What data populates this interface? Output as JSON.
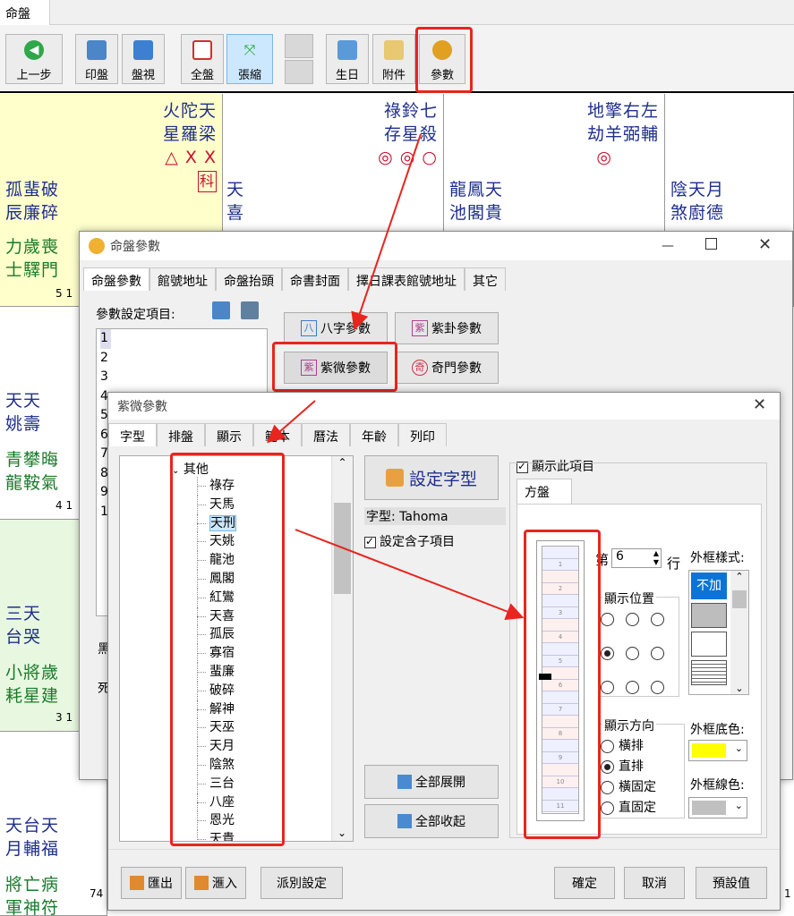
{
  "app": {
    "tab_label": "命盤"
  },
  "toolbar": {
    "back": "上一步",
    "print": "印盤",
    "view": "盤視",
    "full": "全盤",
    "zoom": "張縮",
    "birthday": "生日",
    "attach": "附件",
    "params": "參數"
  },
  "chart": {
    "c1_stars": [
      "火陀天",
      "星羅梁"
    ],
    "c1_marks": "△ X X",
    "c1_ke": "科",
    "c1_left": [
      "孤蜚破",
      "辰廉碎"
    ],
    "c1_bottom": [
      "力歲喪",
      "士驛門"
    ],
    "c1_num": "5 1",
    "c2_stars": [
      "祿鈴七",
      "存星殺"
    ],
    "c2_marks": "◎ ◎ ○",
    "c2_left": [
      "天",
      "喜"
    ],
    "c3_stars": [
      "地擎右左",
      "劫羊弼輔"
    ],
    "c3_marks": "◎",
    "c3_left": [
      "龍鳳天",
      "池閣貴"
    ],
    "c4_left": [
      "陰天月",
      "煞廚德"
    ],
    "r2_left": [
      "天天",
      "姚壽"
    ],
    "r2_bottom": [
      "青攀晦",
      "龍鞍氣"
    ],
    "r2_num": "4 1",
    "r3_left": [
      "三天",
      "台哭"
    ],
    "r3_bottom": [
      "小將歲",
      "耗星建"
    ],
    "r3_num": "3 1",
    "r4_left": [
      "天台天",
      "月輔福"
    ],
    "r4_bottom": [
      "將亡病",
      "軍神符"
    ],
    "r4_num": "74",
    "r4_num_right": "1",
    "side_chars": [
      "黑",
      "死"
    ]
  },
  "win1": {
    "title": "命盤參數",
    "tabs": [
      "命盤參數",
      "館號地址",
      "命盤抬頭",
      "命書封面",
      "擇日課表館號地址",
      "其它"
    ],
    "label": "參數設定項目:",
    "list": [
      "1",
      "2",
      "3",
      "4",
      "5",
      "6",
      "7",
      "8",
      "9",
      "1"
    ],
    "btn_bazi": "八字參數",
    "btn_zigua": "紫卦參數",
    "btn_ziwei": "紫微參數",
    "btn_qimen": "奇門參數"
  },
  "win2": {
    "title": "紫微參數",
    "tabs": [
      "字型",
      "排盤",
      "顯示",
      "範本",
      "曆法",
      "年齡",
      "列印"
    ],
    "tree_root": "其他",
    "tree_items": [
      "祿存",
      "天馬",
      "天刑",
      "天姚",
      "龍池",
      "鳳閣",
      "紅鸞",
      "天喜",
      "孤辰",
      "寡宿",
      "蜚廉",
      "破碎",
      "解神",
      "天巫",
      "天月",
      "陰煞",
      "三台",
      "八座",
      "恩光",
      "天貴"
    ],
    "tree_selected": "天刑",
    "set_font": "設定字型",
    "font_label": "字型: Tahoma",
    "set_children": "設定含子項目",
    "show_item": "顯示此項目",
    "panel_tab": "方盤",
    "row_prefix": "第",
    "row_value": "6",
    "row_suffix": "行",
    "pos_label": "顯示位置",
    "dir_label": "顯示方向",
    "dir_options": [
      "橫排",
      "直排",
      "橫固定",
      "直固定"
    ],
    "frame_style": "外框樣式:",
    "frame_none": "不加",
    "frame_bg": "外框底色:",
    "frame_line": "外框線色:",
    "expand_all": "全部展開",
    "collapse_all": "全部收起",
    "export": "匯出",
    "import": "滙入",
    "school": "派別設定",
    "ok": "確定",
    "cancel": "取消",
    "default": "預設值",
    "grid_nums": [
      "1",
      "2",
      "3",
      "4",
      "5",
      "6",
      "7",
      "8",
      "9",
      "10",
      "11"
    ]
  },
  "colors": {
    "highlight": "#e8251e",
    "yellow_cell": "#ffffcc",
    "green_cell": "#e8f8e0",
    "accent_blue": "#1f2f8c"
  }
}
